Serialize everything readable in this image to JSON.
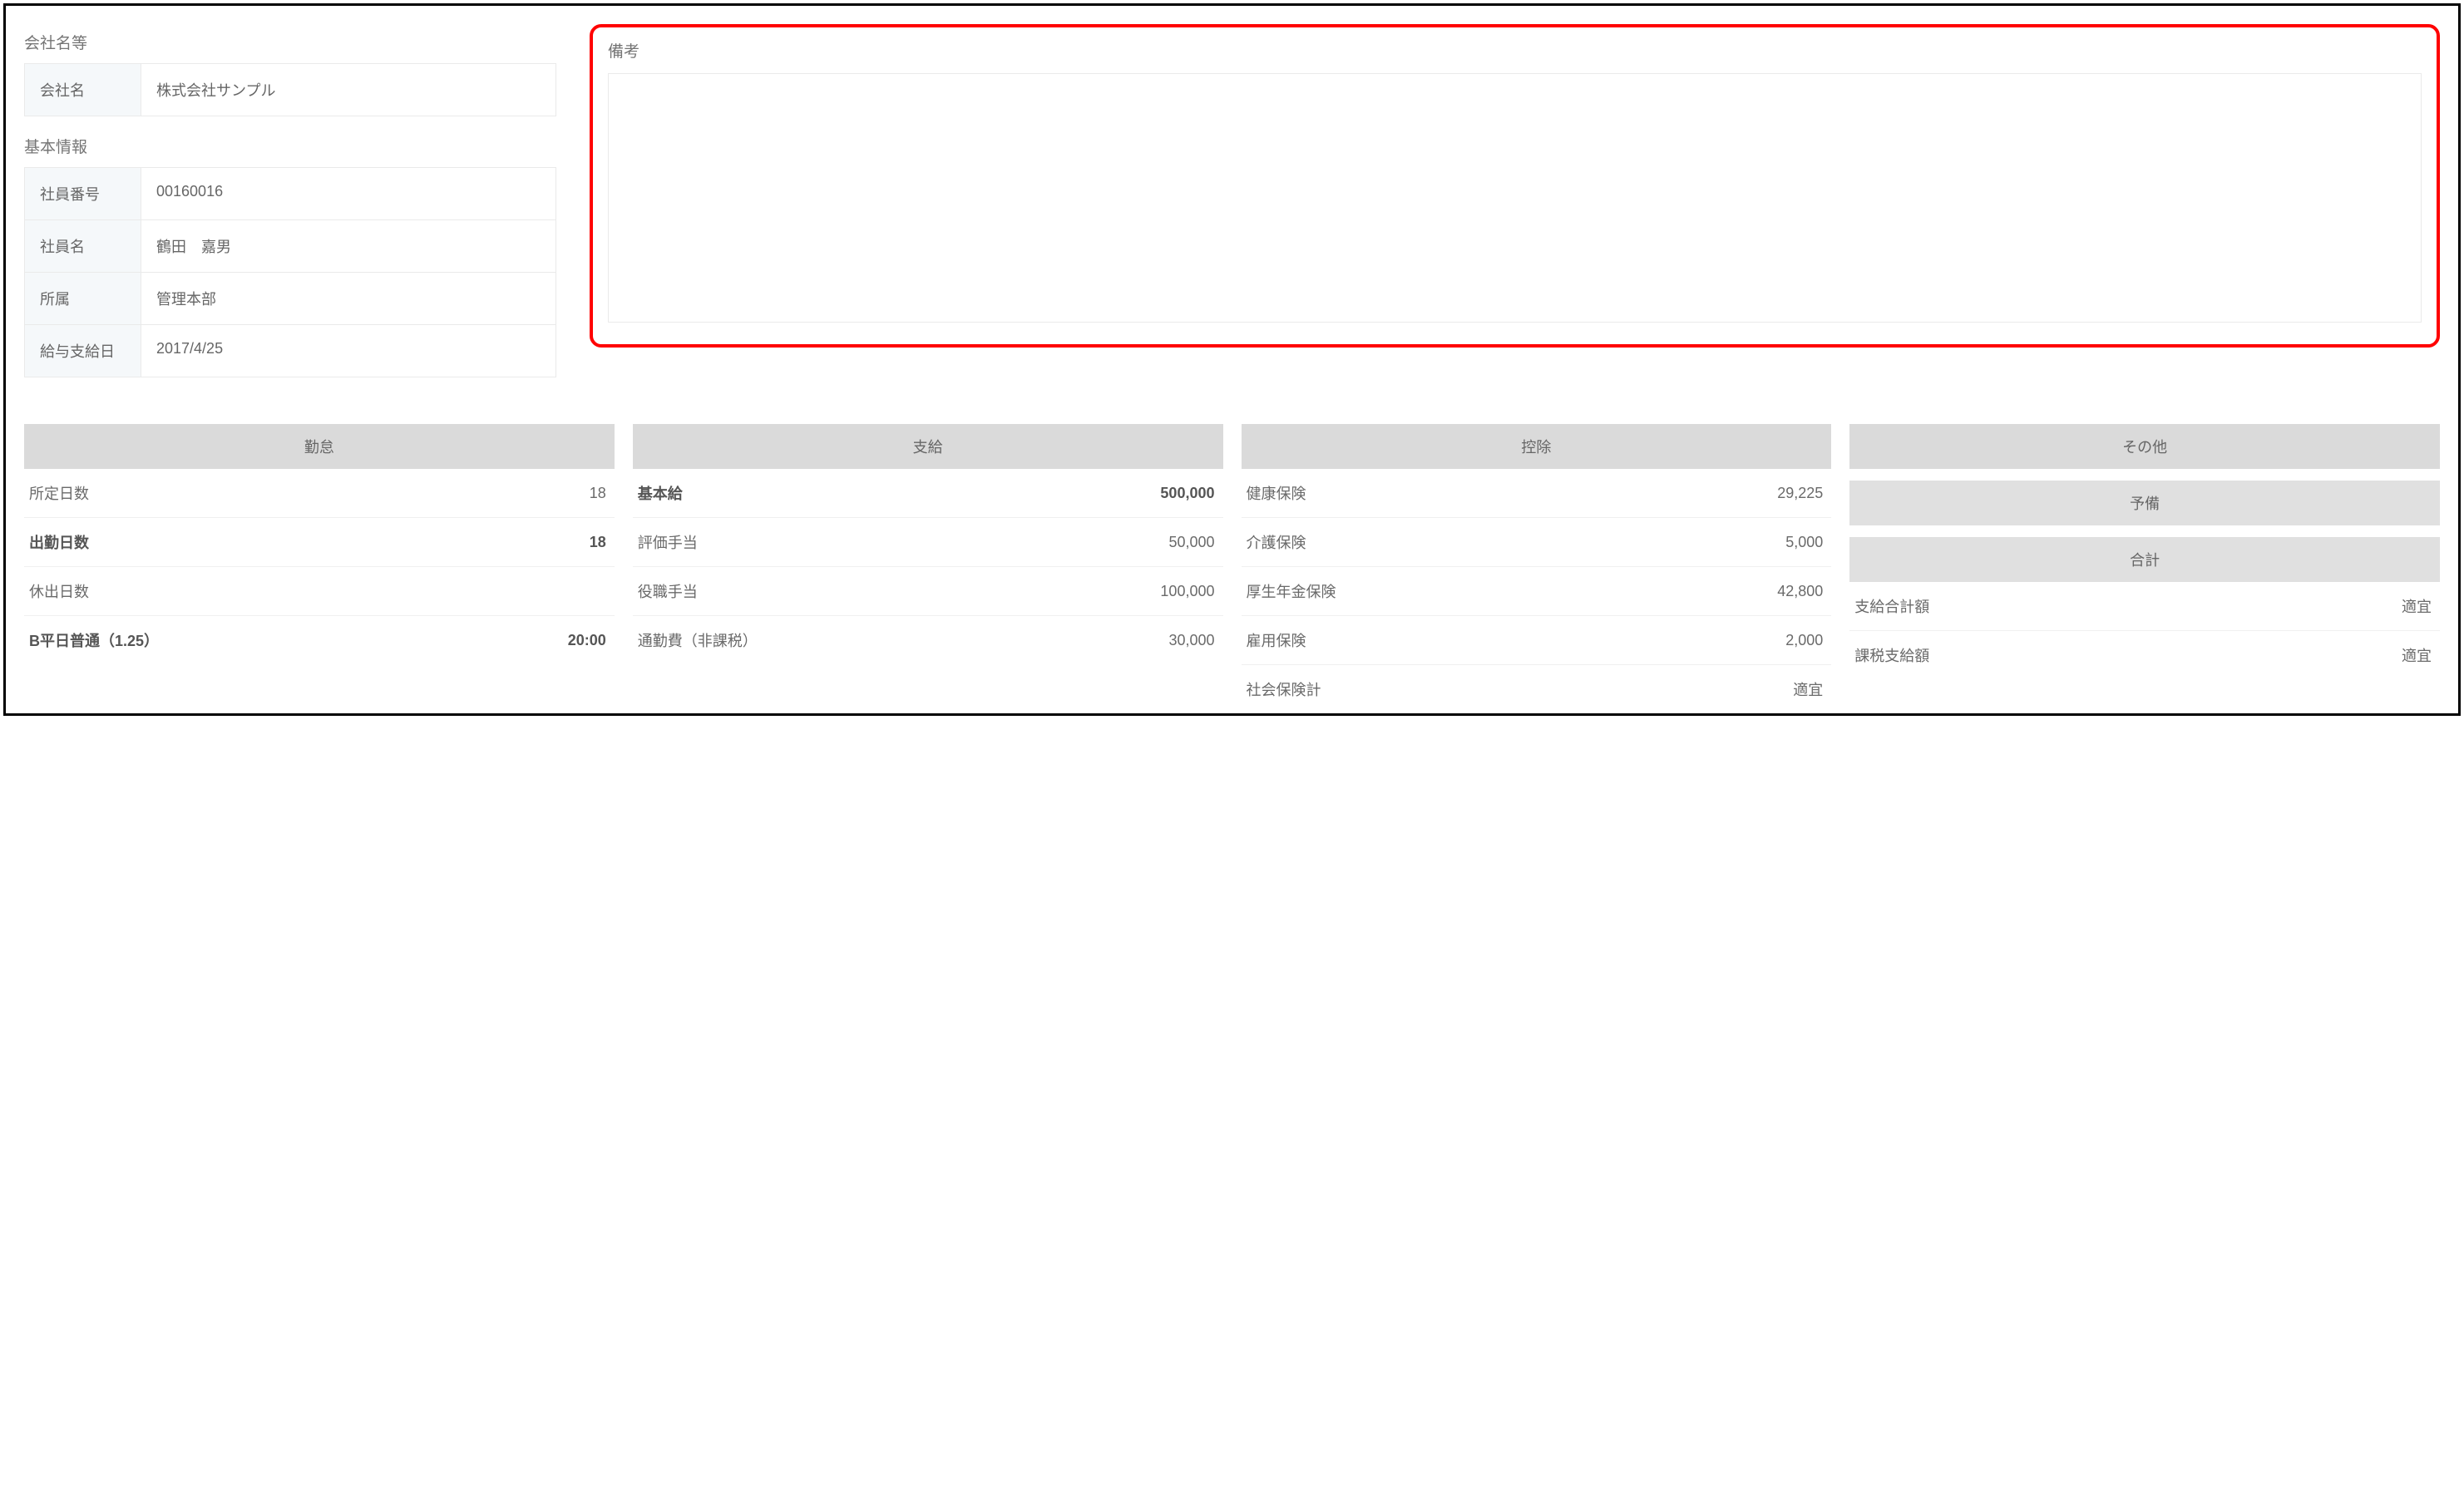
{
  "company_section": {
    "heading": "会社名等",
    "company_label": "会社名",
    "company_value": "株式会社サンプル"
  },
  "basic_info": {
    "heading": "基本情報",
    "rows": [
      {
        "label": "社員番号",
        "value": "00160016"
      },
      {
        "label": "社員名",
        "value": "鶴田　嘉男"
      },
      {
        "label": "所属",
        "value": "管理本部"
      },
      {
        "label": "給与支給日",
        "value": "2017/4/25"
      }
    ]
  },
  "remarks": {
    "heading": "備考",
    "value": ""
  },
  "columns": {
    "attendance": {
      "header": "勤怠",
      "rows": [
        {
          "label": "所定日数",
          "value": "18",
          "bold": false
        },
        {
          "label": "出勤日数",
          "value": "18",
          "bold": true
        },
        {
          "label": "休出日数",
          "value": "",
          "bold": false
        },
        {
          "label": "B平日普通（1.25）",
          "value": "20:00",
          "bold": true
        }
      ]
    },
    "payment": {
      "header": "支給",
      "rows": [
        {
          "label": "基本給",
          "value": "500,000",
          "bold": true
        },
        {
          "label": "評価手当",
          "value": "50,000",
          "bold": false
        },
        {
          "label": "役職手当",
          "value": "100,000",
          "bold": false
        },
        {
          "label": "通勤費（非課税）",
          "value": "30,000",
          "bold": false
        }
      ]
    },
    "deduction": {
      "header": "控除",
      "rows": [
        {
          "label": "健康保険",
          "value": "29,225",
          "bold": false
        },
        {
          "label": "介護保険",
          "value": "5,000",
          "bold": false
        },
        {
          "label": "厚生年金保険",
          "value": "42,800",
          "bold": false
        },
        {
          "label": "雇用保険",
          "value": "2,000",
          "bold": false
        },
        {
          "label": "社会保険計",
          "value": "適宜",
          "bold": false
        }
      ]
    },
    "other": {
      "header": "その他",
      "reserve_header": "予備",
      "total_header": "合計",
      "total_rows": [
        {
          "label": "支給合計額",
          "value": "適宜",
          "bold": false
        },
        {
          "label": "課税支給額",
          "value": "適宜",
          "bold": false
        }
      ]
    }
  }
}
